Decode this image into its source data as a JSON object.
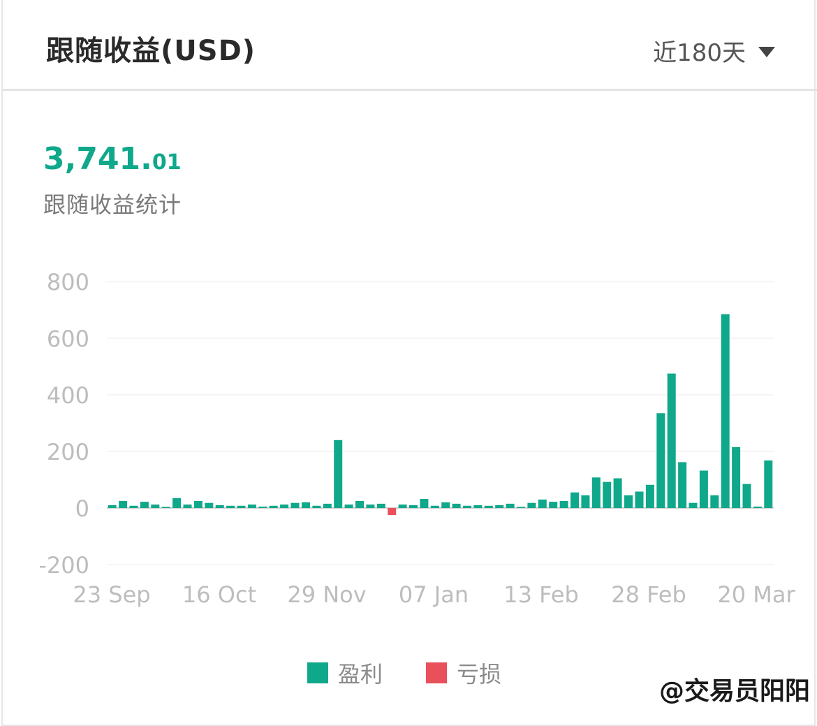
{
  "header": {
    "title": "跟随收益(USD)",
    "period_label": "近180天"
  },
  "summary": {
    "total_int": "3,741.",
    "total_dec": "01",
    "label": "跟随收益统计"
  },
  "watermark": "@交易员阳阳",
  "colors": {
    "profit": "#0fa88a",
    "loss": "#e8505b"
  },
  "chart_data": {
    "type": "bar",
    "title": "",
    "xlabel": "",
    "ylabel": "",
    "ylim": [
      -200,
      800
    ],
    "yticks": [
      "800",
      "600",
      "400",
      "200",
      "0",
      "-200"
    ],
    "xtick_labels": [
      "23 Sep",
      "16 Oct",
      "29 Nov",
      "07 Jan",
      "13 Feb",
      "28 Feb",
      "20 Mar"
    ],
    "grid": true,
    "legend": {
      "position": "bottom",
      "entries": [
        {
          "label": "盈利",
          "color": "#0fa88a"
        },
        {
          "label": "亏损",
          "color": "#e8505b"
        }
      ]
    },
    "values": [
      10,
      25,
      8,
      22,
      12,
      4,
      35,
      12,
      25,
      18,
      10,
      8,
      8,
      12,
      5,
      8,
      12,
      18,
      20,
      8,
      15,
      240,
      12,
      25,
      12,
      15,
      -25,
      12,
      10,
      32,
      8,
      20,
      15,
      8,
      10,
      8,
      10,
      15,
      4,
      18,
      30,
      22,
      25,
      55,
      45,
      108,
      92,
      105,
      45,
      58,
      82,
      335,
      475,
      162,
      18,
      132,
      45,
      685,
      215,
      85,
      5,
      168
    ]
  }
}
